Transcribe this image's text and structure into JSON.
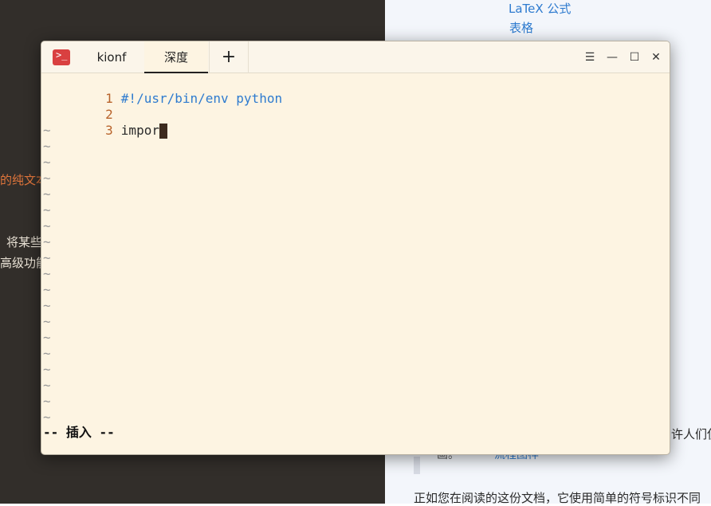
{
  "background": {
    "link_latex": "LaTeX 公式",
    "link_table": "表格",
    "left_text_1": "的纯文本",
    "left_text_2": "将某些",
    "left_text_3": "高级功能",
    "right_partial": "许人们使",
    "doc_bottom": "正如您在阅读的这份文档，它使用简单的符号标识不同",
    "under_text": "画。",
    "under_link": "流程图样"
  },
  "terminal": {
    "tabs": [
      "kionf",
      "深度"
    ],
    "add_tab": "+",
    "controls": {
      "menu": "☰",
      "minimize": "—",
      "maximize": "☐",
      "close": "✕"
    },
    "lines": [
      {
        "num": "1",
        "text": "#!/usr/bin/env python"
      },
      {
        "num": "2",
        "text": ""
      },
      {
        "num": "3",
        "text": "impor"
      }
    ],
    "tilde": "~",
    "tilde_count": 19,
    "status": "-- 插入 --",
    "colors": {
      "line_numbers": "#b8632b",
      "shebang": "#2e7bcf",
      "background": "#fdf4e2",
      "cursor": "#3c2b1e"
    }
  }
}
